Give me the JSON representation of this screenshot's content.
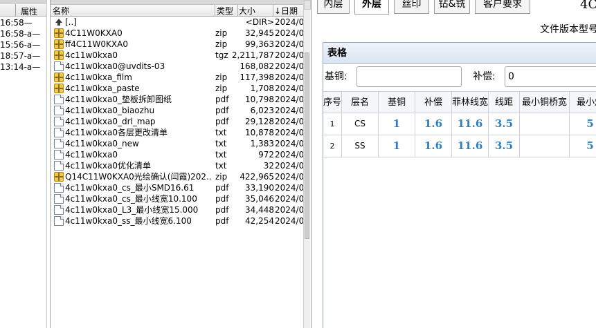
{
  "left_pane": {
    "header": "属性",
    "rows": [
      "16:58—",
      "16:58-a—",
      "15:56-a—",
      "18:57-a—",
      "13:14-a—"
    ]
  },
  "file_pane": {
    "columns": {
      "name": "名称",
      "type": "类型",
      "size": "大小",
      "date": "↓日期"
    },
    "files": [
      {
        "icon": "up-dir-icon",
        "name": "[..]",
        "type": "",
        "size": "<DIR>",
        "date": "2024/0"
      },
      {
        "icon": "zip-icon",
        "name": "4C11W0KXA0",
        "type": "zip",
        "size": "32,945",
        "date": "2024/0"
      },
      {
        "icon": "zip-icon",
        "name": "ff4C11W0KXA0",
        "type": "zip",
        "size": "99,363",
        "date": "2024/0"
      },
      {
        "icon": "zip-icon",
        "name": "4c11w0kxa0",
        "type": "tgz",
        "size": "2,211,787",
        "date": "2024/0"
      },
      {
        "icon": "document-icon",
        "name": "4c11w0kxa0@uvdits-03",
        "type": "",
        "size": "168,082",
        "date": "2024/0"
      },
      {
        "icon": "zip-icon",
        "name": "4c11w0kxa_film",
        "type": "zip",
        "size": "117,398",
        "date": "2024/0"
      },
      {
        "icon": "zip-icon",
        "name": "4c11w0kxa_paste",
        "type": "zip",
        "size": "1,708",
        "date": "2024/0"
      },
      {
        "icon": "document-icon",
        "name": "4c11w0kxa0_垫板拆卸图纸",
        "type": "pdf",
        "size": "10,798",
        "date": "2024/0"
      },
      {
        "icon": "document-icon",
        "name": "4c11w0kxa0_biaozhu",
        "type": "pdf",
        "size": "6,023",
        "date": "2024/0"
      },
      {
        "icon": "document-icon",
        "name": "4c11w0kxa0_drl_map",
        "type": "pdf",
        "size": "29,128",
        "date": "2024/0"
      },
      {
        "icon": "document-icon",
        "name": "4c11w0kxa0各层更改清单",
        "type": "txt",
        "size": "10,878",
        "date": "2024/0"
      },
      {
        "icon": "document-icon",
        "name": "4c11w0kxa0_new",
        "type": "txt",
        "size": "1,383",
        "date": "2024/0"
      },
      {
        "icon": "document-icon",
        "name": "4c11w0kxa0",
        "type": "txt",
        "size": "972",
        "date": "2024/0"
      },
      {
        "icon": "document-icon",
        "name": "4c11w0kxa0优化清单",
        "type": "txt",
        "size": "32",
        "date": "2024/0"
      },
      {
        "icon": "zip-icon",
        "name": "Q14C11W0KXA0光绘确认(闫霞)202..",
        "type": "zip",
        "size": "422,965",
        "date": "2024/0"
      },
      {
        "icon": "document-icon",
        "name": "4c11w0kxa0_cs_最小SMD16.61",
        "type": "pdf",
        "size": "33,190",
        "date": "2024/0"
      },
      {
        "icon": "document-icon",
        "name": "4c11w0kxa0_cs_最小线宽10.100",
        "type": "pdf",
        "size": "35,046",
        "date": "2024/0"
      },
      {
        "icon": "document-icon",
        "name": "4c11w0kxa0_L3_最小线宽15.000",
        "type": "pdf",
        "size": "34,448",
        "date": "2024/0"
      },
      {
        "icon": "document-icon",
        "name": "4c11w0kxa0_ss_最小线宽6.100",
        "type": "pdf",
        "size": "42,254",
        "date": "2024/0"
      }
    ]
  },
  "app_pane": {
    "tabs": [
      {
        "label": "内层",
        "active": false
      },
      {
        "label": "外层",
        "active": true
      },
      {
        "label": "丝印",
        "active": false
      },
      {
        "label": "钻&铣",
        "active": false
      },
      {
        "label": "客户要求",
        "active": false
      }
    ],
    "title_right": "4C",
    "version_label": "文件版本型号",
    "panel_title": "表格",
    "filters": {
      "base_copper_label": "基铜:",
      "base_copper_value": "",
      "compensation_label": "补偿:",
      "compensation_value": "0"
    },
    "grid": {
      "headers": [
        "序号",
        "层名",
        "基铜",
        "补偿",
        "菲林线宽",
        "线距",
        "最小铜桥宽",
        "最小焊"
      ],
      "rows": [
        {
          "idx": "1",
          "layer": "CS",
          "base": "1",
          "comp": "1.6",
          "film": "11.6",
          "spacing": "3.5",
          "bridge": "",
          "minpad": "5"
        },
        {
          "idx": "2",
          "layer": "SS",
          "base": "1",
          "comp": "1.6",
          "film": "11.6",
          "spacing": "3.5",
          "bridge": "",
          "minpad": "5"
        }
      ]
    }
  }
}
